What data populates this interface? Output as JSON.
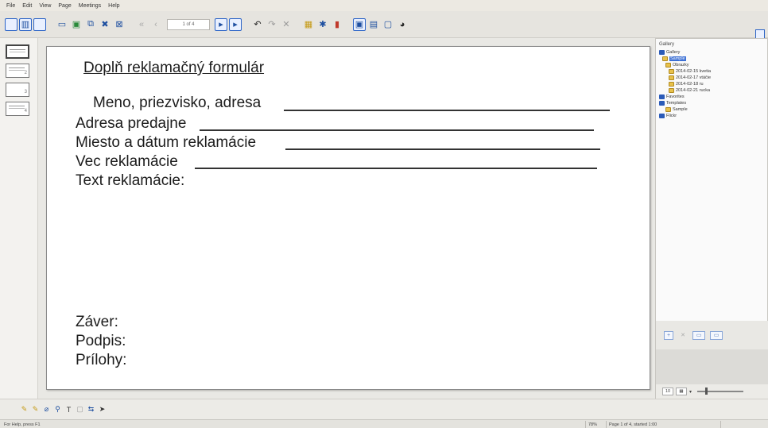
{
  "menu": {
    "items": [
      "File",
      "Edit",
      "View",
      "Page",
      "Meetings",
      "Help"
    ]
  },
  "toolbar": {
    "page_indicator": "1 of 4"
  },
  "thumbnails": [
    {
      "label": ""
    },
    {
      "label": "2"
    },
    {
      "label": "3"
    },
    {
      "label": "4"
    }
  ],
  "document": {
    "title": "Doplň reklamačný formulár",
    "fields": [
      "Meno, priezvisko, adresa",
      "Adresa predajne",
      "Miesto a dátum reklamácie",
      "Vec reklamácie",
      "Text reklamácie:"
    ],
    "footer_fields": [
      "Záver:",
      "Podpis:",
      "Prílohy:"
    ]
  },
  "gallery": {
    "header": "Gallery",
    "tree": [
      {
        "label": "Gallery",
        "icon": "gallery-icon"
      },
      {
        "label": "Sample",
        "icon": "folder-icon",
        "selected": true
      },
      {
        "label": "Obrazky",
        "icon": "folder-icon"
      },
      {
        "label": "2014-02-15 kvetia",
        "icon": "folder-icon"
      },
      {
        "label": "2014-02-17 vtáčie",
        "icon": "folder-icon"
      },
      {
        "label": "2014-02-18 ru",
        "icon": "folder-icon"
      },
      {
        "label": "2014-02-21 rucka",
        "icon": "folder-icon"
      },
      {
        "label": "Favorites",
        "icon": "gallery-icon"
      },
      {
        "label": "Templates",
        "icon": "gallery-icon"
      },
      {
        "label": "Sample",
        "icon": "folder-icon"
      },
      {
        "label": "Flickr",
        "icon": "gallery-icon"
      }
    ],
    "zoom_value": "10"
  },
  "statusbar": {
    "help_text": "For Help, press F1",
    "zoom": "78%",
    "page_info": "Page 1 of 4, started 1:00"
  },
  "colors": {
    "accent": "#2b63c6",
    "selection": "#3b6fd4",
    "folder": "#e8c14a"
  }
}
